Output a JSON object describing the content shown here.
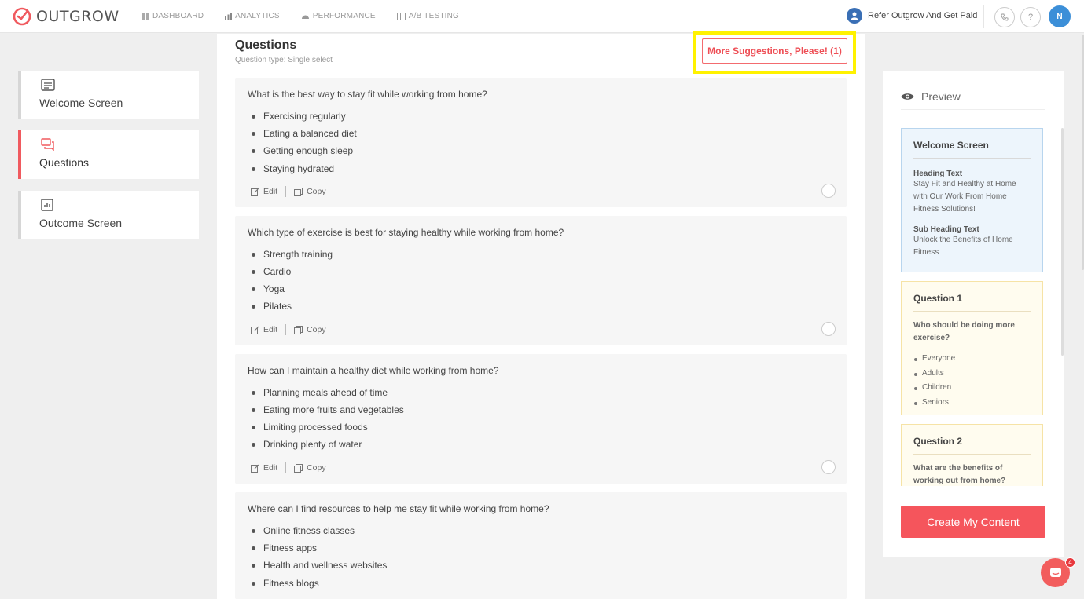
{
  "app": {
    "name": "OUTGROW",
    "nav": [
      {
        "label": "DASHBOARD",
        "icon": "dashboard-icon"
      },
      {
        "label": "ANALYTICS",
        "icon": "analytics-icon"
      },
      {
        "label": "PERFORMANCE",
        "icon": "performance-icon"
      },
      {
        "label": "A/B TESTING",
        "icon": "ab-testing-icon"
      }
    ],
    "refer_label": "Refer Outgrow And Get Paid",
    "avatar_initial": "N",
    "help_label": "?",
    "colors": {
      "accent": "#f5555c",
      "highlight": "#fff200",
      "avatar": "#3c8fd8"
    }
  },
  "steps": [
    {
      "label": "Welcome Screen",
      "icon": "welcome-screen-icon",
      "active": false
    },
    {
      "label": "Questions",
      "icon": "questions-icon",
      "active": true
    },
    {
      "label": "Outcome Screen",
      "icon": "outcome-screen-icon",
      "active": false
    }
  ],
  "questions_panel": {
    "title": "Questions",
    "subtitle": "Question type: Single select",
    "suggest_label": "More Suggestions, Please! (1)",
    "edit_label": "Edit",
    "copy_label": "Copy",
    "questions": [
      {
        "text": "What is the best way to stay fit while working from home?",
        "options": [
          "Exercising regularly",
          "Eating a balanced diet",
          "Getting enough sleep",
          "Staying hydrated"
        ]
      },
      {
        "text": "Which type of exercise is best for staying healthy while working from home?",
        "options": [
          "Strength training",
          "Cardio",
          "Yoga",
          "Pilates"
        ]
      },
      {
        "text": "How can I maintain a healthy diet while working from home?",
        "options": [
          "Planning meals ahead of time",
          "Eating more fruits and vegetables",
          "Limiting processed foods",
          "Drinking plenty of water"
        ]
      },
      {
        "text": "Where can I find resources to help me stay fit while working from home?",
        "options": [
          "Online fitness classes",
          "Fitness apps",
          "Health and wellness websites",
          "Fitness blogs"
        ]
      }
    ]
  },
  "preview": {
    "title": "Preview",
    "welcome": {
      "title": "Welcome Screen",
      "heading_label": "Heading Text",
      "heading_value": "Stay Fit and Healthy at Home with Our Work From Home Fitness Solutions!",
      "subheading_label": "Sub Heading Text",
      "subheading_value": "Unlock the Benefits of Home Fitness"
    },
    "question1": {
      "title": "Question 1",
      "text": "Who should be doing more exercise?",
      "options": [
        "Everyone",
        "Adults",
        "Children",
        "Seniors"
      ]
    },
    "question2": {
      "title": "Question 2",
      "text": "What are the benefits of working out from home?"
    },
    "create_label": "Create My Content"
  },
  "chat": {
    "badge": "4"
  }
}
